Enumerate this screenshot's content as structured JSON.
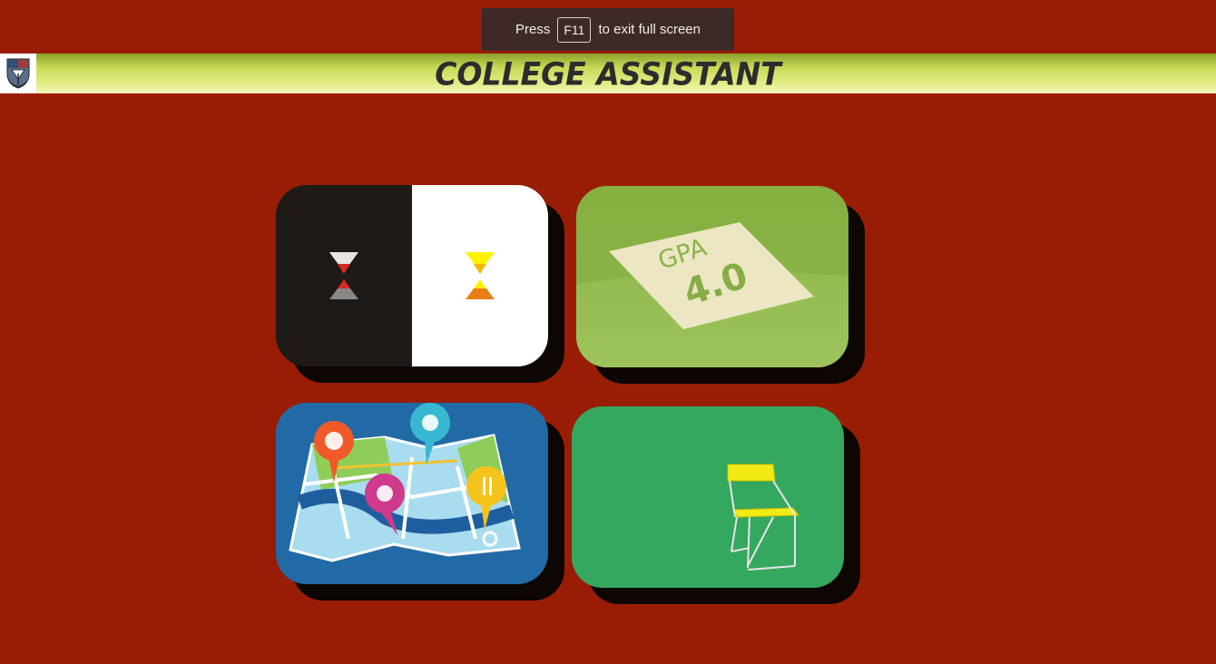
{
  "fullscreen_notice": {
    "prefix": "Press",
    "key": "F11",
    "suffix": "to exit full screen"
  },
  "header": {
    "title": "COLLEGE ASSISTANT",
    "logo_icon": "college-crest-logo"
  },
  "tiles": [
    {
      "id": "timer",
      "icon": "hourglass-icon"
    },
    {
      "id": "gpa",
      "icon": "gpa-paper-icon",
      "paper_text_line1": "GPA",
      "paper_text_line2": "4.0"
    },
    {
      "id": "map",
      "icon": "campus-map-icon"
    },
    {
      "id": "seat",
      "icon": "folding-chair-icon"
    }
  ],
  "colors": {
    "background": "#991d04",
    "header_gradient_top": "#8aa22a",
    "header_gradient_bottom": "#f3f6b8",
    "title_text": "#2c2c2c"
  }
}
